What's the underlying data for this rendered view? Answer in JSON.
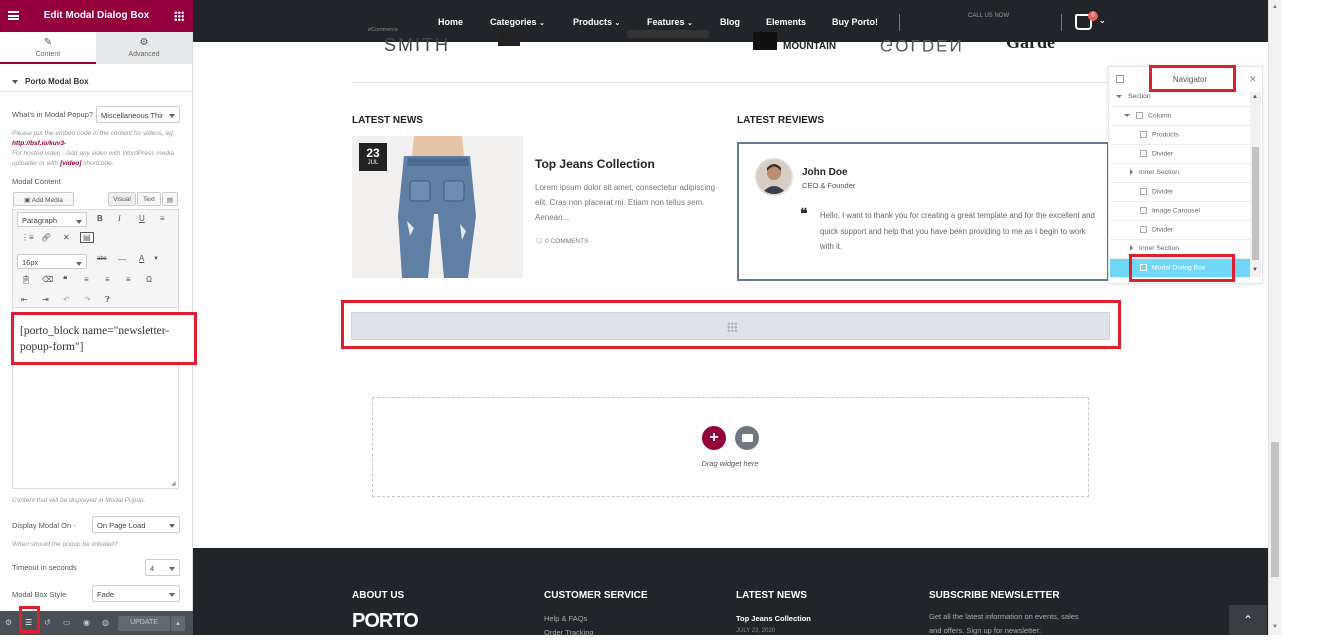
{
  "panel": {
    "title": "Edit Modal Dialog Box",
    "tabs": [
      {
        "label": "Content",
        "icon": "pencil-icon"
      },
      {
        "label": "Advanced",
        "icon": "gear-icon"
      }
    ],
    "section_title": "Porto Modal Box",
    "modal_popup_label": "What's in Modal Popup?",
    "modal_popup_value": "Miscellaneous Thir",
    "embed_note_1": "Please put the embed code in the content for videos, eg:",
    "embed_link": "http://bsf.io/kuv3-",
    "embed_note_2": "For hosted video - Add any video with WordPress media uploader or with",
    "embed_video_tag": "[video]",
    "embed_note_3": "shortcode.",
    "modal_content_label": "Modal Content",
    "add_media": "Add Media",
    "visual_tab": "Visual",
    "text_tab": "Text",
    "paragraph_select": "Paragraph",
    "font_size_select": "16px",
    "shortcode": "[porto_block name=\"newsletter-popup-form\"]",
    "content_note": "Content that will be displayed in Modal Popup.",
    "display_on_label": "Display Modal On -",
    "display_on_value": "On Page Load",
    "display_note": "When should the popup be initiated?",
    "timeout_label": "Timeout in seconds",
    "timeout_value": "4",
    "box_style_label": "Modal Box Style",
    "box_style_value": "Fade",
    "update_button": "UPDATE"
  },
  "site": {
    "nav": [
      "Home",
      "Categories",
      "Products",
      "Features",
      "Blog",
      "Elements",
      "Buy Porto!"
    ],
    "call_us": "CALL US NOW",
    "ecommerce": "eCommerce",
    "cart_count": "0",
    "brands": [
      "SMITH",
      "MOUNTAIN",
      "GOLDEN",
      "Garde"
    ],
    "latest_news_title": "LATEST NEWS",
    "latest_reviews_title": "LATEST REVIEWS",
    "news": {
      "day": "23",
      "month": "JUL",
      "title": "Top Jeans Collection",
      "excerpt": "Lorem ipsum dolor sit amet, consectetur adipiscing elit. Cras non placerat mi. Etiam non tellus sem. Aenean...",
      "comments": "0 COMMENTS"
    },
    "review": {
      "name": "John Doe",
      "role": "CEO & Founder",
      "text": "Hello, I want to thank you for creating a great template and for the excellent and quick support and help that you have been providing to me as I begin to work with it."
    },
    "drag_widget": "Drag widget here",
    "footer": {
      "about": "ABOUT US",
      "logo": "PORTO",
      "customer_service": "CUSTOMER SERVICE",
      "help": "Help & FAQs",
      "order_tracking": "Order Tracking",
      "latest_news": "LATEST NEWS",
      "news_item": "Top Jeans Collection",
      "news_date": "JULY 23, 2020",
      "subscribe": "SUBSCRIBE NEWSLETTER",
      "subscribe_text": "Get all the latest information on events, sales and offers. Sign up for newsletter:"
    }
  },
  "navigator": {
    "title": "Navigator",
    "items": [
      {
        "label": "Section",
        "type": "section"
      },
      {
        "label": "Column",
        "type": "column"
      },
      {
        "label": "Products",
        "type": "widget"
      },
      {
        "label": "Divider",
        "type": "widget"
      },
      {
        "label": "Inner Section",
        "type": "inner"
      },
      {
        "label": "Divider",
        "type": "widget"
      },
      {
        "label": "Image Carousel",
        "type": "widget"
      },
      {
        "label": "Divider",
        "type": "widget"
      },
      {
        "label": "Inner Section",
        "type": "inner"
      },
      {
        "label": "Modal Dialog Box",
        "type": "active"
      }
    ]
  },
  "colors": {
    "brand": "#93003c",
    "highlight": "#e01e2e",
    "navigator_active": "#71d7f7",
    "header_dark": "#212529"
  }
}
